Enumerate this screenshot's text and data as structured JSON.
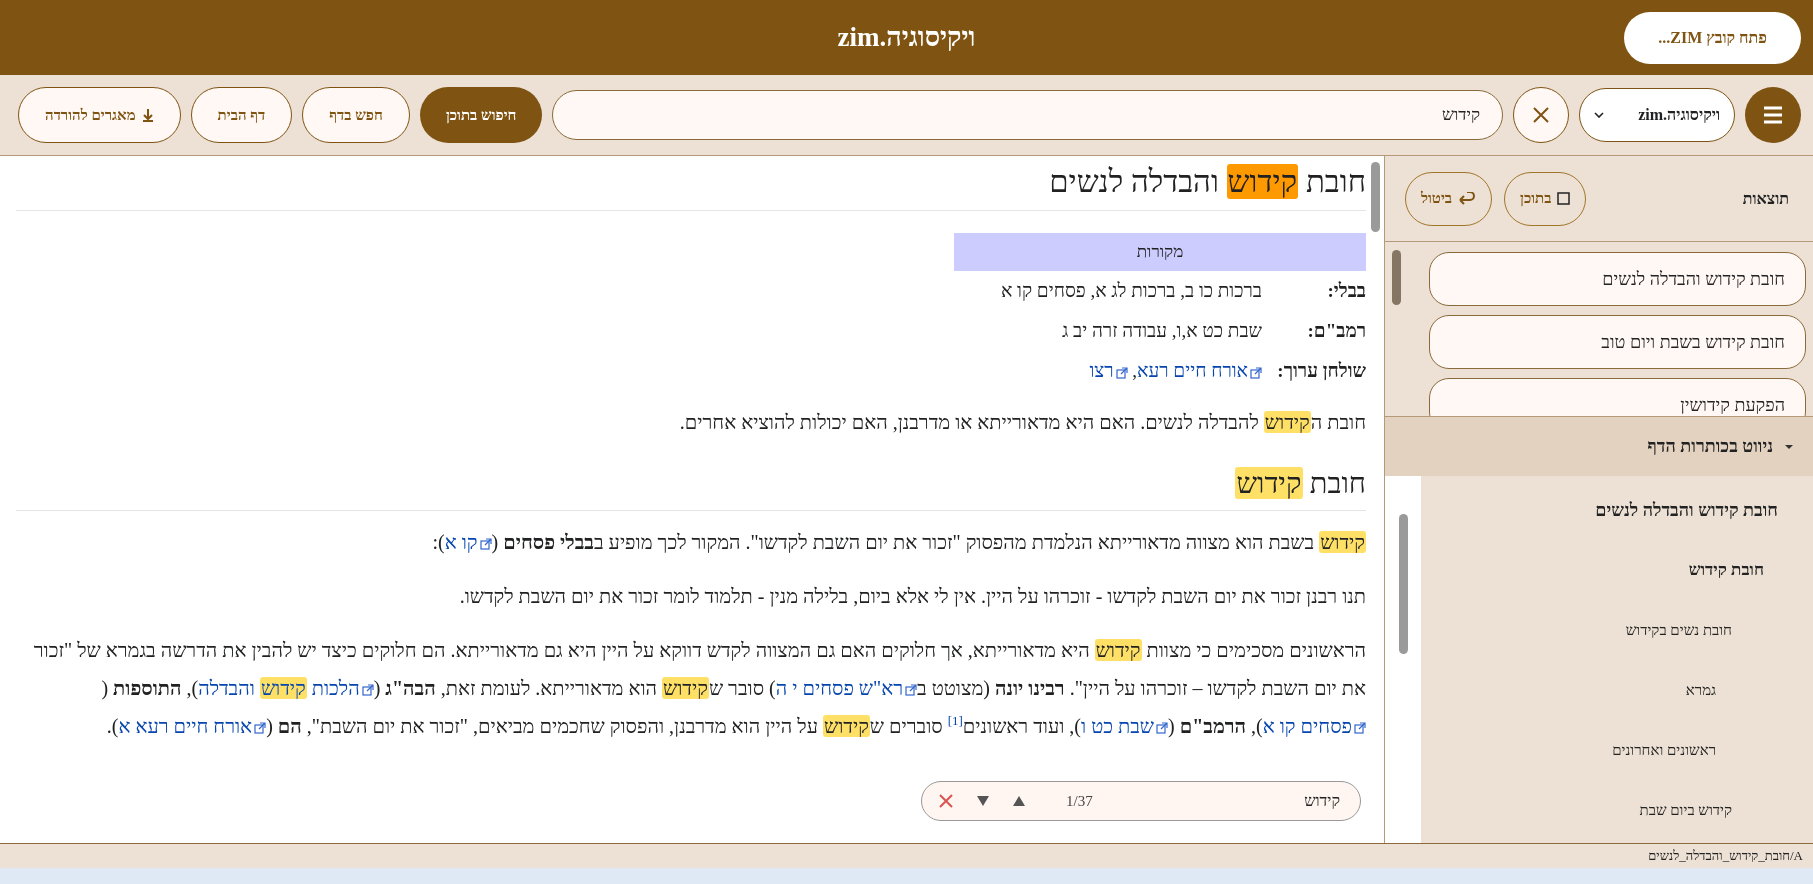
{
  "header": {
    "title": "ויקיסוגיה.zim",
    "open_button": "פתח קובץ ZIM..."
  },
  "toolbar": {
    "library": "ויקיסוגיה.zim",
    "search": {
      "value": "קידוש"
    },
    "buttons": [
      {
        "label": "חיפוש בתוכן",
        "primary": true,
        "kind": "plain"
      },
      {
        "label": "חפש בדף",
        "primary": false,
        "kind": "plain"
      },
      {
        "label": "דף הבית",
        "primary": false,
        "kind": "plain"
      },
      {
        "label": "מאגרים להורדה",
        "primary": false,
        "kind": "download"
      }
    ]
  },
  "article": {
    "title": [
      {
        "kind": "text",
        "text": "חובת "
      },
      {
        "kind": "current",
        "text": "קידוש"
      },
      {
        "kind": "text",
        "text": " והבדלה לנשים"
      }
    ],
    "infobox": {
      "title": "מקורות",
      "rows": [
        {
          "label": "בבלי:",
          "value": [
            {
              "kind": "text",
              "text": "ברכות כו ב, ברכות לג א, פסחים קו א"
            }
          ]
        },
        {
          "label": "רמב\"ם:",
          "value": [
            {
              "kind": "text",
              "text": "שבת כט א,ו, עבודה זרה יב ג"
            }
          ]
        },
        {
          "label": "שולחן ערוך:",
          "value": [
            {
              "kind": "link",
              "text": "אורח חיים רעא"
            },
            {
              "kind": "text",
              "text": ", "
            },
            {
              "kind": "link",
              "text": "רצו"
            }
          ]
        }
      ]
    },
    "intro": [
      {
        "kind": "text",
        "text": "חובת ה"
      },
      {
        "kind": "mark",
        "text": "קידוש"
      },
      {
        "kind": "text",
        "text": " להבדלה לנשים. האם היא מדאורייתא או מדרבנן, האם יכולות להוציא אחרים."
      }
    ],
    "sections": [
      {
        "heading": [
          {
            "kind": "text",
            "text": "חובת "
          },
          {
            "kind": "mark",
            "text": "קידוש"
          }
        ],
        "paragraphs": [
          [
            {
              "kind": "mark",
              "text": "קידוש"
            },
            {
              "kind": "text",
              "text": " בשבת הוא מצווה מדאורייתא הנלמדת מהפסוק \"זכור את יום השבת לקדשו\". המקור לכך מופיע ב"
            },
            {
              "kind": "bold",
              "text": "בבלי פסחים"
            },
            {
              "kind": "text",
              "text": " ("
            },
            {
              "kind": "link",
              "text": "קו א"
            },
            {
              "kind": "text",
              "text": "):"
            }
          ],
          [
            {
              "kind": "text",
              "text": "תנו רבנן זכור את יום השבת לקדשו - זוכרהו על היין. אין לי אלא ביום, בלילה מנין - תלמוד לומר זכור את יום השבת לקדשו."
            }
          ],
          [
            {
              "kind": "text",
              "text": "הראשונים מסכימים כי מצוות "
            },
            {
              "kind": "mark",
              "text": "קידוש"
            },
            {
              "kind": "text",
              "text": " היא מדאורייתא, אך חלוקים האם גם המצווה לקדש דווקא על היין היא גם מדאורייתא. הם חלוקים כיצד יש להבין את הדרשה בגמרא של \"זכור את יום השבת לקדשו – זוכרהו על היין\". "
            },
            {
              "kind": "bold",
              "text": "רבינו יונה"
            },
            {
              "kind": "text",
              "text": " (מצוטט ב"
            },
            {
              "kind": "link",
              "text": "רא\"ש פסחים י ה"
            },
            {
              "kind": "text",
              "text": ") סובר ש"
            },
            {
              "kind": "mark",
              "text": "קידוש"
            },
            {
              "kind": "text",
              "text": " הוא מדאורייתא. לעומת זאת, "
            },
            {
              "kind": "bold",
              "text": "הבה\"ג"
            },
            {
              "kind": "text",
              "text": " ("
            },
            {
              "kind": "link",
              "text": "הלכות "
            },
            {
              "kind": "linkmark",
              "text": "קידוש"
            },
            {
              "kind": "linkcont",
              "text": " והבדלה"
            },
            {
              "kind": "text",
              "text": "), "
            },
            {
              "kind": "bold",
              "text": "התוספות"
            },
            {
              "kind": "text",
              "text": " ("
            },
            {
              "kind": "link",
              "text": "פסחים קו א"
            },
            {
              "kind": "text",
              "text": "), "
            },
            {
              "kind": "bold",
              "text": "הרמב\"ם"
            },
            {
              "kind": "text",
              "text": " ("
            },
            {
              "kind": "link",
              "text": "שבת כט ו"
            },
            {
              "kind": "text",
              "text": "), ועוד ראשונים"
            },
            {
              "kind": "ref",
              "text": "[1]"
            },
            {
              "kind": "text",
              "text": " סוברים ש"
            },
            {
              "kind": "mark",
              "text": "קידוש"
            },
            {
              "kind": "text",
              "text": " על היין הוא מדרבנן, והפסוק שחכמים מביאים, \"זכור את יום השבת\", "
            },
            {
              "kind": "bold",
              "text": "הם"
            },
            {
              "kind": "text",
              "text": " ("
            },
            {
              "kind": "link",
              "text": "אורח חיים רעא א"
            },
            {
              "kind": "text",
              "text": ")."
            }
          ]
        ]
      }
    ]
  },
  "find_bar": {
    "query": "קידוש",
    "count": "1/37"
  },
  "sidebar": {
    "results_title": "תוצאות",
    "result_buttons": [
      {
        "label": "בתוכן",
        "kind": "checkbox"
      },
      {
        "label": "ביטול",
        "kind": "undo"
      }
    ],
    "results": [
      "חובת קידוש והבדלה לנשים",
      "חובת קידוש בשבת ויום טוב",
      "הפקעת קידושין"
    ],
    "nav": {
      "title": "ניווט בכותרות הדף",
      "expanded": true
    },
    "toc": [
      {
        "label": "חובת קידוש והבדלה לנשים",
        "children": [
          {
            "label": "חובת קידוש",
            "children": [
              {
                "label": "חובת נשים בקידוש",
                "children": [
                  {
                    "label": "גמרא"
                  },
                  {
                    "label": "ראשונים ואחרונים"
                  }
                ]
              },
              {
                "label": "קידוש ביום שבת"
              }
            ]
          }
        ]
      }
    ]
  },
  "status_bar": {
    "path": "A/חובת_קידוש_והבדלה_לנשים"
  }
}
